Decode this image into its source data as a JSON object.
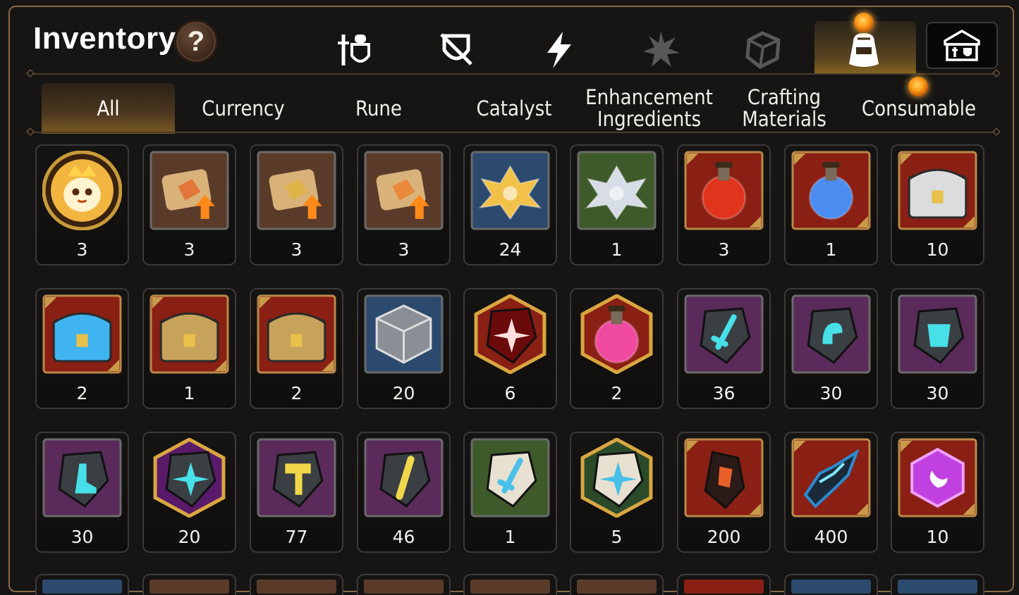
{
  "title": "Inventory",
  "help_label": "?",
  "category_icons": [
    {
      "name": "equipment-icon",
      "active": false
    },
    {
      "name": "shield-crossed-icon",
      "active": false
    },
    {
      "name": "lightning-icon",
      "active": false
    },
    {
      "name": "burst-icon",
      "active": false
    },
    {
      "name": "cube-icon",
      "active": false
    },
    {
      "name": "bag-icon",
      "active": true
    }
  ],
  "guild_button_icon": "guild-crest-icon",
  "tabs": [
    {
      "label": "All",
      "active": true
    },
    {
      "label": "Currency",
      "active": false
    },
    {
      "label": "Rune",
      "active": false
    },
    {
      "label": "Catalyst",
      "active": false
    },
    {
      "label": "Enhancement\nIngredients",
      "active": false
    },
    {
      "label": "Crafting\nMaterials",
      "active": false
    },
    {
      "label": "Consumable",
      "active": false,
      "notification": true
    }
  ],
  "items": [
    {
      "icon": "mascot-coin-icon",
      "count": "3",
      "bg": "#3a2a1a",
      "frame": "round",
      "tint": "#f2b640"
    },
    {
      "icon": "dragon-scroll-icon",
      "count": "3",
      "bg": "#5a3b2a",
      "frame": "plain",
      "tint": "#e4763a"
    },
    {
      "icon": "rainbow-scroll-icon",
      "count": "3",
      "bg": "#5a3b2a",
      "frame": "plain",
      "tint": "#e0b34a"
    },
    {
      "icon": "scroll-upgrade-icon",
      "count": "3",
      "bg": "#5a3b2a",
      "frame": "plain",
      "tint": "#e88a3a"
    },
    {
      "icon": "gold-lotus-icon",
      "count": "24",
      "bg": "#2c4a6e",
      "frame": "plain",
      "tint": "#f1c14a"
    },
    {
      "icon": "silver-lotus-icon",
      "count": "1",
      "bg": "#3f5a2a",
      "frame": "plain",
      "tint": "#d7dde6"
    },
    {
      "icon": "red-potion-icon",
      "count": "3",
      "bg": "#8a1f14",
      "frame": "ornate",
      "tint": "#e0341c"
    },
    {
      "icon": "star-potion-icon",
      "count": "1",
      "bg": "#8a1f14",
      "frame": "ornate",
      "tint": "#4a8cf0"
    },
    {
      "icon": "white-chest-icon",
      "count": "10",
      "bg": "#8a1f14",
      "frame": "ornate",
      "tint": "#dadcde"
    },
    {
      "icon": "blue-chest-icon",
      "count": "2",
      "bg": "#8a1f14",
      "frame": "ornate",
      "tint": "#3fb4f0"
    },
    {
      "icon": "dark-chest-icon",
      "count": "1",
      "bg": "#8a1f14",
      "frame": "ornate",
      "tint": "#c7a25a"
    },
    {
      "icon": "dark-chest-icon",
      "count": "2",
      "bg": "#8a1f14",
      "frame": "ornate",
      "tint": "#c7a25a"
    },
    {
      "icon": "silver-cube-icon",
      "count": "20",
      "bg": "#2c4a6e",
      "frame": "plain",
      "tint": "#8a8f96"
    },
    {
      "icon": "red-star-stone-icon",
      "count": "6",
      "bg": "#8a1f14",
      "frame": "hex",
      "tint": "#d8261f"
    },
    {
      "icon": "pink-potion-icon",
      "count": "2",
      "bg": "#8a1f14",
      "frame": "hex",
      "tint": "#f04aa0"
    },
    {
      "icon": "sword-rune-icon",
      "count": "36",
      "bg": "#5a2a5a",
      "frame": "plain",
      "tint": "#48e0e8"
    },
    {
      "icon": "helm-rune-icon",
      "count": "30",
      "bg": "#5a2a5a",
      "frame": "plain",
      "tint": "#48e0e8"
    },
    {
      "icon": "armor-rune-icon",
      "count": "30",
      "bg": "#5a2a5a",
      "frame": "plain",
      "tint": "#48e0e8"
    },
    {
      "icon": "boot-rune-icon",
      "count": "30",
      "bg": "#5a2a5a",
      "frame": "plain",
      "tint": "#48e0e8"
    },
    {
      "icon": "star-rune-icon",
      "count": "20",
      "bg": "#5a1a6a",
      "frame": "hex",
      "tint": "#48e0e8"
    },
    {
      "icon": "hammer-rune-icon",
      "count": "77",
      "bg": "#5a2a5a",
      "frame": "plain",
      "tint": "#f0d84a"
    },
    {
      "icon": "slash-rune-icon",
      "count": "46",
      "bg": "#5a2a5a",
      "frame": "plain",
      "tint": "#f0d84a"
    },
    {
      "icon": "pale-sword-stone-icon",
      "count": "1",
      "bg": "#3f5a2a",
      "frame": "plain",
      "tint": "#48c0e8"
    },
    {
      "icon": "pale-star-stone-icon",
      "count": "5",
      "bg": "#2a4a2a",
      "frame": "hex",
      "tint": "#48c0e8"
    },
    {
      "icon": "ember-core-icon",
      "count": "200",
      "bg": "#8a1f14",
      "frame": "ornate",
      "tint": "#e8602a"
    },
    {
      "icon": "crystal-shard-icon",
      "count": "400",
      "bg": "#8a1f14",
      "frame": "ornate",
      "tint": "#2a8cd0"
    },
    {
      "icon": "moon-gem-icon",
      "count": "10",
      "bg": "#8a1f14",
      "frame": "ornate",
      "tint": "#c040e0"
    }
  ],
  "bottom_row_peek": [
    "#2c4a6e",
    "#5a3b2a",
    "#5a3b2a",
    "#5a3b2a",
    "#5a3b2a",
    "#5a3b2a",
    "#8a1f14",
    "#2c4a6e",
    "#2c4a6e"
  ]
}
